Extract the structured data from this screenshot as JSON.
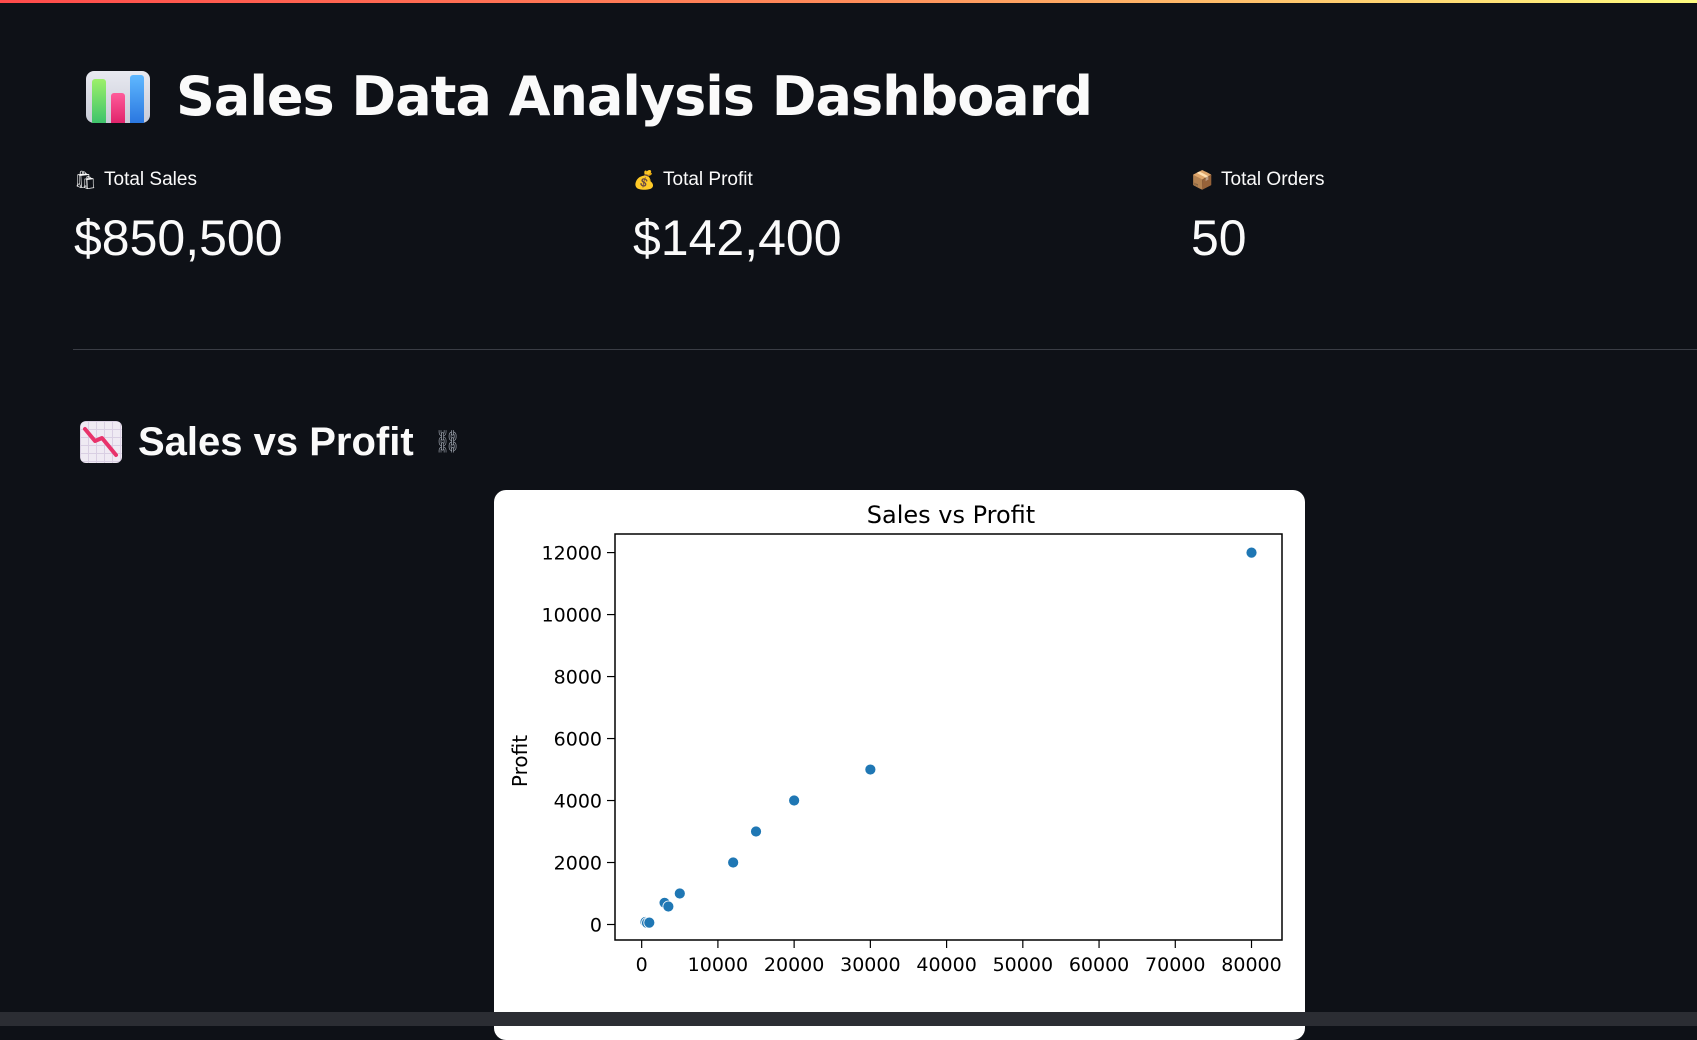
{
  "header": {
    "title": "Sales Data Analysis Dashboard",
    "icon": "bar-chart-icon"
  },
  "metrics": [
    {
      "icon": "shopping-bags-icon",
      "glyph": "🛍",
      "label": "Total Sales",
      "value": "$850,500"
    },
    {
      "icon": "money-bag-icon",
      "glyph": "💰",
      "label": "Total Profit",
      "value": "$142,400"
    },
    {
      "icon": "package-icon",
      "glyph": "📦",
      "label": "Total Orders",
      "value": "50"
    }
  ],
  "section": {
    "title": "Sales vs Profit",
    "icon": "chart-decreasing-icon",
    "link_icon": "link-icon",
    "link_glyph": "⛓"
  },
  "colors": {
    "background": "#0e1117",
    "text": "#fafafa",
    "point": "#1f77b4"
  },
  "chart_data": {
    "type": "scatter",
    "title": "Sales vs Profit",
    "xlabel": "",
    "ylabel": "Profit",
    "xlim": [
      -3500,
      84000
    ],
    "ylim": [
      -500,
      12600
    ],
    "xticks": [
      0,
      10000,
      20000,
      30000,
      40000,
      50000,
      60000,
      70000,
      80000
    ],
    "yticks": [
      0,
      2000,
      4000,
      6000,
      8000,
      10000,
      12000
    ],
    "points": [
      {
        "x": 500,
        "y": 80
      },
      {
        "x": 700,
        "y": 50
      },
      {
        "x": 1000,
        "y": 60
      },
      {
        "x": 3000,
        "y": 700
      },
      {
        "x": 3500,
        "y": 580
      },
      {
        "x": 5000,
        "y": 1000
      },
      {
        "x": 12000,
        "y": 2000
      },
      {
        "x": 15000,
        "y": 3000
      },
      {
        "x": 20000,
        "y": 4000
      },
      {
        "x": 30000,
        "y": 5000
      },
      {
        "x": 80000,
        "y": 12000
      }
    ]
  }
}
